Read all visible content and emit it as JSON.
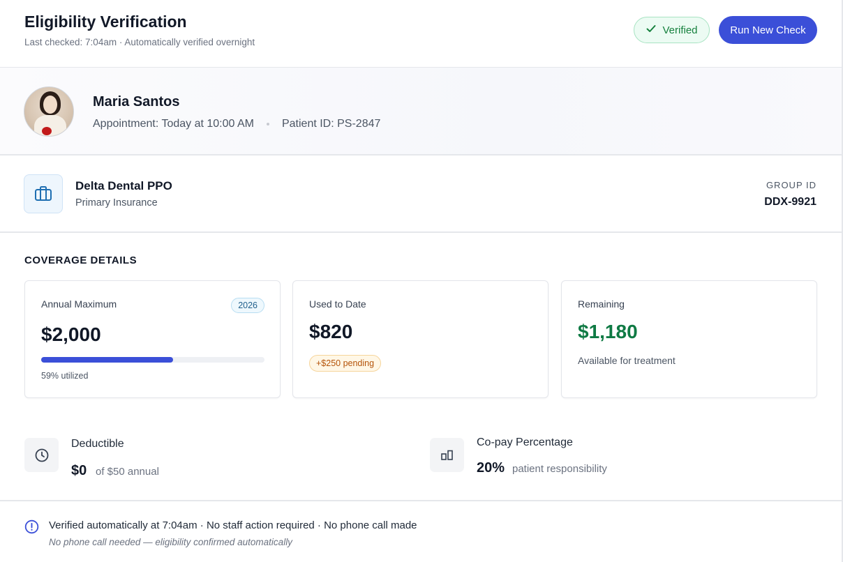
{
  "header": {
    "title": "Eligibility Verification",
    "subtitle": "Last checked: 7:04am · Automatically verified overnight",
    "status_badge": "Verified",
    "run_button": "Run New Check"
  },
  "patient": {
    "name": "Maria Santos",
    "appointment": "Appointment: Today at 10:00 AM",
    "patient_id": "Patient ID: PS-2847"
  },
  "insurance": {
    "name": "Delta Dental PPO",
    "type": "Primary Insurance",
    "group_label": "GROUP ID",
    "group_id": "DDX-9921"
  },
  "coverage": {
    "heading": "COVERAGE DETAILS",
    "annual": {
      "label": "Annual Maximum",
      "year": "2026",
      "amount": "$2,000",
      "utilized_fraction": 0.59,
      "utilized_text": "59% utilized"
    },
    "used": {
      "label": "Used to Date",
      "amount": "$820",
      "pending": "+$250 pending"
    },
    "remaining": {
      "label": "Remaining",
      "amount": "$1,180",
      "note": "Available for treatment"
    }
  },
  "stats": {
    "deductible": {
      "label": "Deductible",
      "value": "$0",
      "sub": "of $50 annual"
    },
    "copay": {
      "label": "Co-pay Percentage",
      "value": "20%",
      "sub": "patient responsibility"
    }
  },
  "footer": {
    "main": "Verified automatically at 7:04am · No staff action required · No phone call made",
    "sub": "No phone call needed — eligibility confirmed automatically"
  },
  "colors": {
    "accent": "#3b4fd8",
    "success": "#15803d",
    "remaining_amount": "#0f7a44",
    "pending": "#b45309",
    "info": "#3b4fd8"
  },
  "icons": {
    "status": "check-icon",
    "insurance": "briefcase-icon",
    "deductible": "clock-icon",
    "copay": "bar-chart-icon",
    "footer": "info-icon"
  }
}
